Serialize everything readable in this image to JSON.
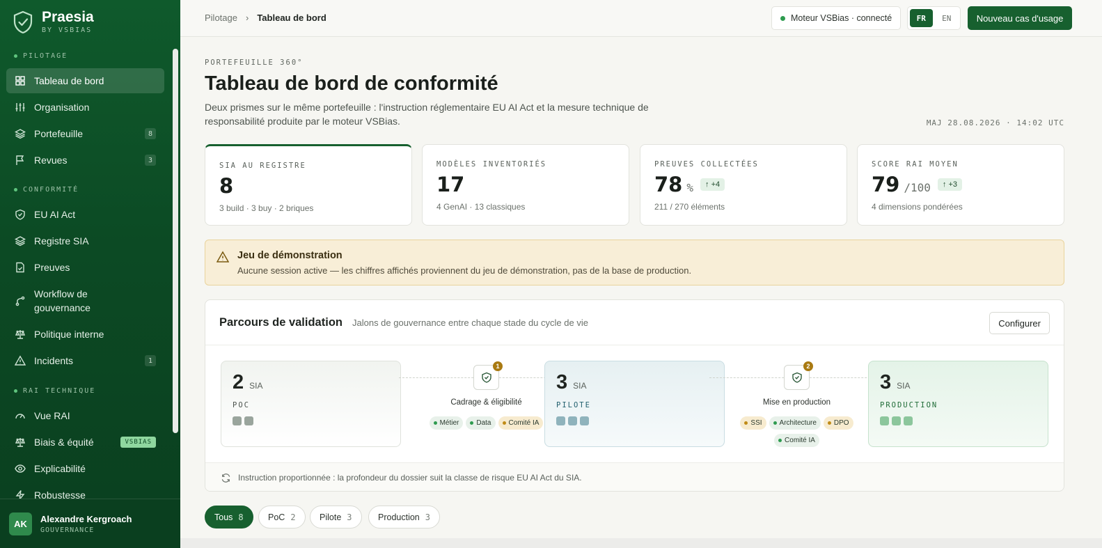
{
  "brand": {
    "name": "Praesia",
    "sub": "BY VSBIAS"
  },
  "sidebar": {
    "sections": [
      {
        "label": "PILOTAGE"
      },
      {
        "label": "CONFORMITÉ"
      },
      {
        "label": "RAI TECHNIQUE"
      }
    ],
    "items": [
      {
        "label": "Tableau de bord",
        "icon": "grid-icon",
        "active": true
      },
      {
        "label": "Organisation",
        "icon": "sliders-icon"
      },
      {
        "label": "Portefeuille",
        "icon": "layers-icon",
        "badge": "8"
      },
      {
        "label": "Revues",
        "icon": "flag-icon",
        "badge": "3"
      },
      {
        "label": "EU AI Act",
        "icon": "shield-check-icon"
      },
      {
        "label": "Registre SIA",
        "icon": "layers-icon"
      },
      {
        "label": "Preuves",
        "icon": "document-check-icon"
      },
      {
        "label": "Workflow de gouvernance",
        "label_line1": "Workflow de",
        "label_line2": "gouvernance",
        "icon": "git-branch-icon"
      },
      {
        "label": "Politique interne",
        "icon": "scale-icon"
      },
      {
        "label": "Incidents",
        "icon": "warning-icon",
        "badge": "1"
      },
      {
        "label": "Vue RAI",
        "icon": "gauge-icon"
      },
      {
        "label": "Biais & équité",
        "icon": "scale-icon",
        "badge": "VSBIAS"
      },
      {
        "label": "Explicabilité",
        "icon": "eye-icon"
      },
      {
        "label": "Robustesse",
        "icon": "bolt-icon"
      }
    ]
  },
  "user": {
    "initials": "AK",
    "name": "Alexandre Kergroach",
    "role": "GOUVERNANCE"
  },
  "topbar": {
    "breadcrumb": [
      "Pilotage",
      "Tableau de bord"
    ],
    "engine_status": "Moteur VSBias · connecté",
    "lang": {
      "fr": "FR",
      "en": "EN",
      "selected": "FR"
    },
    "cta": "Nouveau cas d'usage"
  },
  "header": {
    "eyebrow": "PORTEFEUILLE 360°",
    "title": "Tableau de bord de conformité",
    "lede": "Deux prismes sur le même portefeuille : l'instruction réglementaire EU AI Act et la mesure technique de responsabilité produite par le moteur VSBias.",
    "updated": "MAJ 28.08.2026 · 14:02 UTC"
  },
  "kpis": [
    {
      "label": "SIA AU REGISTRE",
      "value": "8",
      "unit": "",
      "delta": "",
      "sub": "3 build · 3 buy · 2 briques"
    },
    {
      "label": "MODÈLES INVENTORIÉS",
      "value": "17",
      "unit": "",
      "delta": "",
      "sub": "4 GenAI · 13 classiques"
    },
    {
      "label": "PREUVES COLLECTÉES",
      "value": "78",
      "unit": "%",
      "delta": "+4",
      "sub": "211 / 270 éléments"
    },
    {
      "label": "SCORE RAI MOYEN",
      "value": "79",
      "unit": "/100",
      "delta": "+3",
      "sub": "4 dimensions pondérées"
    }
  ],
  "notice": {
    "title": "Jeu de démonstration",
    "text": "Aucune session active — les chiffres affichés proviennent du jeu de démonstration, pas de la base de production."
  },
  "validation": {
    "title": "Parcours de validation",
    "subtitle": "Jalons de gouvernance entre chaque stade du cycle de vie",
    "configure": "Configurer",
    "stages": [
      {
        "count": "2",
        "unit": "SIA",
        "code": "POC",
        "squares": 2
      },
      {
        "count": "3",
        "unit": "SIA",
        "code": "PILOTE",
        "squares": 3
      },
      {
        "count": "3",
        "unit": "SIA",
        "code": "PRODUCTION",
        "squares": 3
      }
    ],
    "gates": [
      {
        "label": "Cadrage & éligibilité",
        "count": "1",
        "chips": [
          {
            "t": "Métier"
          },
          {
            "t": "Data"
          },
          {
            "t": "Comité IA",
            "amber": true
          }
        ]
      },
      {
        "label": "Mise en production",
        "count": "2",
        "chips": [
          {
            "t": "SSI",
            "amber": true
          },
          {
            "t": "Architecture"
          },
          {
            "t": "DPO",
            "amber": true
          },
          {
            "t": "Comité IA"
          }
        ]
      }
    ],
    "footer": "Instruction proportionnée : la profondeur du dossier suit la classe de risque EU AI Act du SIA."
  },
  "filters": [
    {
      "label": "Tous",
      "count": "8",
      "active": true
    },
    {
      "label": "PoC",
      "count": "2"
    },
    {
      "label": "Pilote",
      "count": "3"
    },
    {
      "label": "Production",
      "count": "3"
    }
  ],
  "colors": {
    "brand_green": "#17602f",
    "sidebar": "#0c4a24",
    "notice_bg": "#f8eed7",
    "amber": "#a97a12"
  }
}
